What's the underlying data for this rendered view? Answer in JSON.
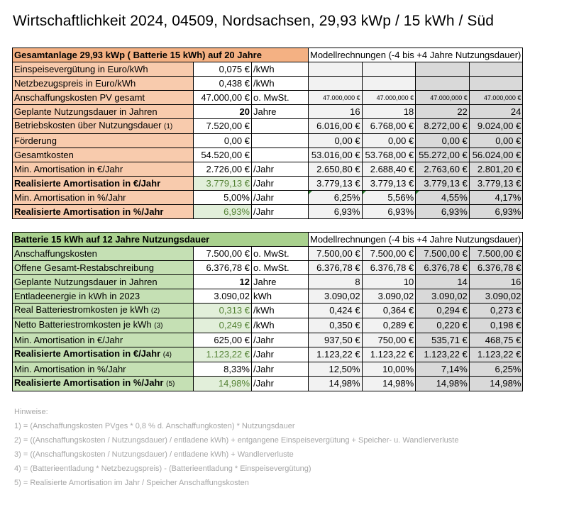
{
  "title": "Wirtschaftlichkeit 2024, 04509, Nordsachsen, 29,93 kWp / 15 kWh / Süd",
  "pv": {
    "header": "Gesamtanlage 29,93 kWp ( Batterie 15 kWh) auf 20 Jahre",
    "model_header": "Modellrechnungen (-4 bis +4 Jahre Nutzungsdauer)",
    "rows": [
      {
        "label": "Einspeisevergütung in Euro/kWh",
        "note": "",
        "value": "0,075 €",
        "unit": "/kWh",
        "m": [
          "",
          "",
          "",
          ""
        ]
      },
      {
        "label": "Netzbezugspreis in Euro/kWh",
        "note": "",
        "value": "0,438 €",
        "unit": "/kWh",
        "m": [
          "",
          "",
          "",
          ""
        ]
      },
      {
        "label": "Anschaffungskosten PV gesamt",
        "note": "",
        "value": "47.000,00 €",
        "unit": "o. MwSt.",
        "m": [
          "47.000,000 €",
          "47.000,000 €",
          "47.000,000 €",
          "47.000,000 €"
        ]
      },
      {
        "label": "Geplante Nutzungsdauer in Jahren",
        "note": "",
        "value": "20",
        "unit": "Jahre",
        "m": [
          "16",
          "18",
          "22",
          "24"
        ]
      },
      {
        "label": "Betriebskosten über Nutzungsdauer",
        "note": "(1)",
        "value": "7.520,00 €",
        "unit": "",
        "m": [
          "6.016,00 €",
          "6.768,00 €",
          "8.272,00 €",
          "9.024,00 €"
        ]
      },
      {
        "label": "Förderung",
        "note": "",
        "value": "0,00 €",
        "unit": "",
        "m": [
          "0,00 €",
          "0,00 €",
          "0,00 €",
          "0,00 €"
        ]
      },
      {
        "label": "Gesamtkosten",
        "note": "",
        "value": "54.520,00 €",
        "unit": "",
        "m": [
          "53.016,00 €",
          "53.768,00 €",
          "55.272,00 €",
          "56.024,00 €"
        ]
      },
      {
        "label": "Min. Amortisation in €/Jahr",
        "note": "",
        "value": "2.726,00 €",
        "unit": "/Jahr",
        "m": [
          "2.650,80 €",
          "2.688,40 €",
          "2.763,60 €",
          "2.801,20 €"
        ]
      },
      {
        "label": "Realisierte Amortisation  in €/Jahr",
        "note": "",
        "value": "3.779,13 €",
        "unit": "/Jahr",
        "m": [
          "3.779,13 €",
          "3.779,13 €",
          "3.779,13 €",
          "3.779,13 €"
        ]
      },
      {
        "label": "Min. Amortisation in %/Jahr",
        "note": "",
        "value": "5,00%",
        "unit": "/Jahr",
        "m": [
          "6,25%",
          "5,56%",
          "4,55%",
          "4,17%"
        ]
      },
      {
        "label": "Realisierte Amortisation in %/Jahr",
        "note": "",
        "value": "6,93%",
        "unit": "/Jahr",
        "m": [
          "6,93%",
          "6,93%",
          "6,93%",
          "6,93%"
        ]
      }
    ]
  },
  "battery": {
    "header": "Batterie 15 kWh auf 12 Jahre Nutzungsdauer",
    "model_header": "Modellrechnungen (-4 bis +4 Jahre Nutzungsdauer)",
    "rows": [
      {
        "label": "Anschaffungskosten",
        "note": "",
        "value": "7.500,00 €",
        "unit": "o. MwSt.",
        "m": [
          "7.500,00 €",
          "7.500,00 €",
          "7.500,00 €",
          "7.500,00 €"
        ]
      },
      {
        "label": "Offene Gesamt-Restabschreibung",
        "note": "",
        "value": "6.376,78 €",
        "unit": "o. MwSt.",
        "m": [
          "6.376,78 €",
          "6.376,78 €",
          "6.376,78 €",
          "6.376,78 €"
        ]
      },
      {
        "label": "Geplante Nutzungsdauer in Jahren",
        "note": "",
        "value": "12",
        "unit": "Jahre",
        "m": [
          "8",
          "10",
          "14",
          "16"
        ]
      },
      {
        "label": "Entladeenergie in kWh in 2023",
        "note": "",
        "value": "3.090,02",
        "unit": "kWh",
        "m": [
          "3.090,02",
          "3.090,02",
          "3.090,02",
          "3.090,02"
        ]
      },
      {
        "label": "Real Batteriestromkosten je kWh",
        "note": "(2)",
        "value": "0,313 €",
        "unit": "/kWh",
        "m": [
          "0,424 €",
          "0,364 €",
          "0,294 €",
          "0,273 €"
        ]
      },
      {
        "label": "Netto Batteriestromkosten je kWh",
        "note": "(3)",
        "value": "0,249 €",
        "unit": "/kWh",
        "m": [
          "0,350 €",
          "0,289 €",
          "0,220 €",
          "0,198 €"
        ]
      },
      {
        "label": "Min. Amortisation in €/Jahr",
        "note": "",
        "value": "625,00 €",
        "unit": "/Jahr",
        "m": [
          "937,50 €",
          "750,00 €",
          "535,71 €",
          "468,75 €"
        ]
      },
      {
        "label": "Realisierte Amortisation  in €/Jahr",
        "note": "(4)",
        "value": "1.123,22 €",
        "unit": "/Jahr",
        "m": [
          "1.123,22 €",
          "1.123,22 €",
          "1.123,22 €",
          "1.123,22 €"
        ]
      },
      {
        "label": "Min. Amortisation in %/Jahr",
        "note": "",
        "value": "8,33%",
        "unit": "/Jahr",
        "m": [
          "12,50%",
          "10,00%",
          "7,14%",
          "6,25%"
        ]
      },
      {
        "label": "Realisierte Amortisation in %/Jahr",
        "note": "(5)",
        "value": "14,98%",
        "unit": "/Jahr",
        "m": [
          "14,98%",
          "14,98%",
          "14,98%",
          "14,98%"
        ]
      }
    ]
  },
  "notes": {
    "heading": "Hinweise:",
    "items": [
      "1) = (Anschaffungskosten PVges * 0,8 % d. Anschaffungkosten) * Nutzungsdauer",
      "2) = ((Anschaffungskosten / Nutzungsdauer) / entladene kWh) + entgangene Einspeisevergütung + Speicher- u. Wandlerverluste",
      "3) = ((Anschaffungskosten / Nutzungsdauer) / entladene kWh) + Wandlerverluste",
      "4) = (Batterieentladung * Netzbezugspreis) - (Batterieentladung * Einspeisevergütung)",
      "5) = Realisierte Amortisation im Jahr / Speicher Anschaffungskosten"
    ]
  },
  "colors": {
    "pv_label_bg": "#f8cbad",
    "pv_header_bg": "#f4b183",
    "battery_label_bg": "#c5e0b4",
    "battery_header_bg": "#a9d18e",
    "highlight_value_bg": "#e2efda",
    "highlight_value_text": "#548235",
    "model_light": "#f2f2f2",
    "model_dark": "#d9d9d9",
    "notes_text": "#a6a6a6"
  }
}
